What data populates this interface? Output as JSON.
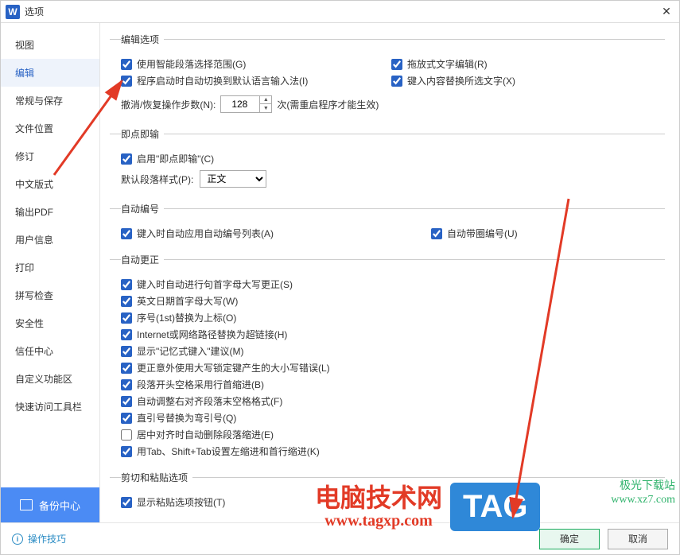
{
  "title": "选项",
  "sidebar": {
    "items": [
      {
        "label": "视图"
      },
      {
        "label": "编辑"
      },
      {
        "label": "常规与保存"
      },
      {
        "label": "文件位置"
      },
      {
        "label": "修订"
      },
      {
        "label": "中文版式"
      },
      {
        "label": "输出PDF"
      },
      {
        "label": "用户信息"
      },
      {
        "label": "打印"
      },
      {
        "label": "拼写检查"
      },
      {
        "label": "安全性"
      },
      {
        "label": "信任中心"
      },
      {
        "label": "自定义功能区"
      },
      {
        "label": "快速访问工具栏"
      }
    ],
    "backup": "备份中心"
  },
  "groups": {
    "edit_options": {
      "legend": "编辑选项",
      "smart_para": "使用智能段落选择范围(G)",
      "drag_edit": "拖放式文字编辑(R)",
      "auto_ime": "程序启动时自动切换到默认语言输入法(I)",
      "overtype": "键入内容替换所选文字(X)",
      "undo_label": "撤消/恢复操作步数(N):",
      "undo_value": "128",
      "undo_suffix": "次(需重启程序才能生效)"
    },
    "click_type": {
      "legend": "即点即输",
      "enable": "启用\"即点即输\"(C)",
      "para_label": "默认段落样式(P):",
      "para_value": "正文"
    },
    "auto_number": {
      "legend": "自动编号",
      "apply_list": "键入时自动应用自动编号列表(A)",
      "circle_num": "自动带圈编号(U)"
    },
    "auto_correct": {
      "legend": "自动更正",
      "items": [
        "键入时自动进行句首字母大写更正(S)",
        "英文日期首字母大写(W)",
        "序号(1st)替换为上标(O)",
        "Internet或网络路径替换为超链接(H)",
        "显示\"记忆式键入\"建议(M)",
        "更正意外使用大写锁定键产生的大小写错误(L)",
        "段落开头空格采用行首缩进(B)",
        "自动调整右对齐段落末空格格式(F)",
        "直引号替换为弯引号(Q)",
        "居中对齐时自动删除段落缩进(E)",
        "用Tab、Shift+Tab设置左缩进和首行缩进(K)"
      ],
      "checked": [
        true,
        true,
        true,
        true,
        true,
        true,
        true,
        true,
        true,
        false,
        true
      ]
    },
    "cut_paste": {
      "legend": "剪切和粘贴选项",
      "show_paste": "显示粘贴选项按钮(T)"
    }
  },
  "footer": {
    "tips": "操作技巧",
    "ok": "确定",
    "cancel": "取消"
  },
  "watermark": {
    "jiguang1": "极光下载站",
    "jiguang2": "www.xz7.com",
    "tagxp1": "电脑技术网",
    "tagxp2": "www.tagxp.com",
    "tag": "TAG"
  }
}
